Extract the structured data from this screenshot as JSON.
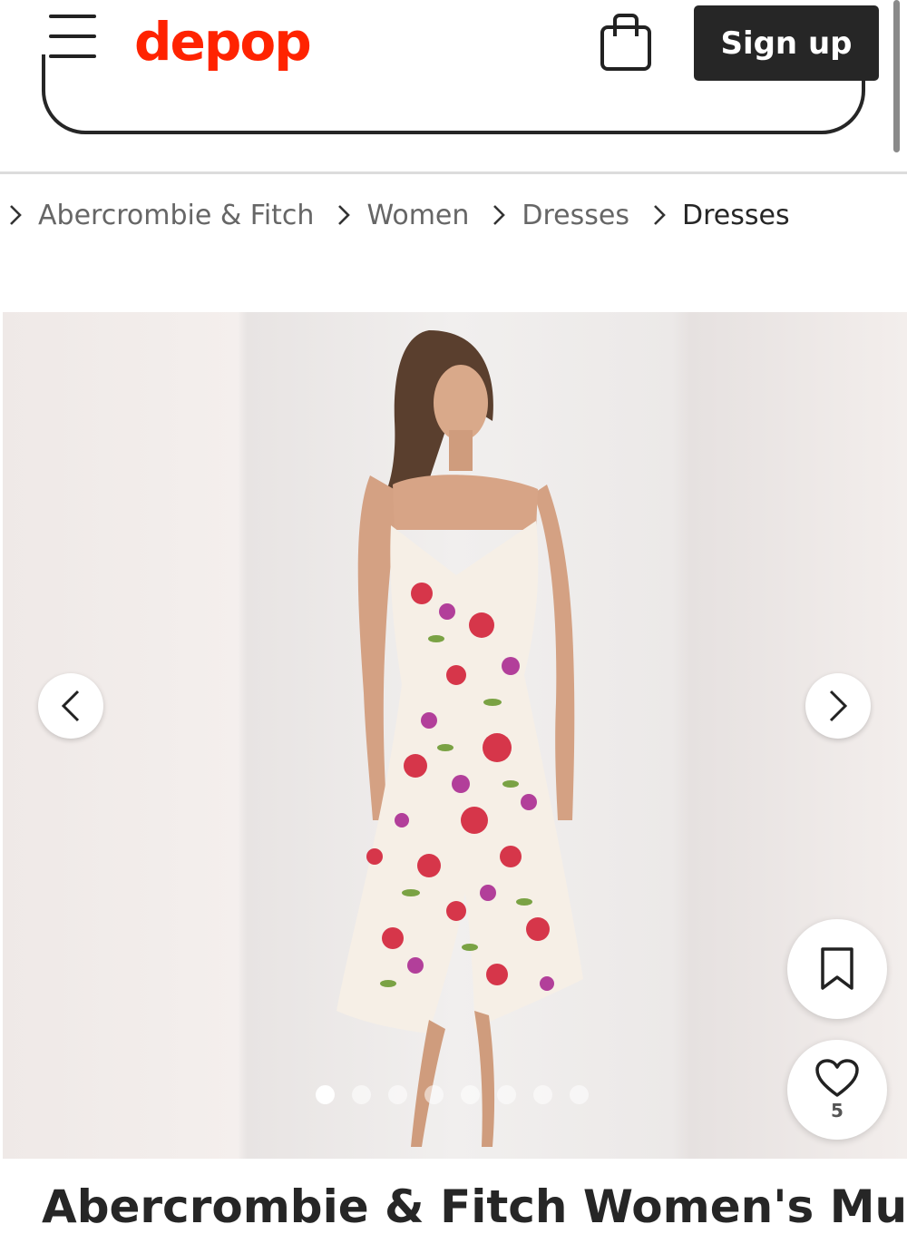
{
  "brand": {
    "logo_text": "depop",
    "logo_color": "#ff2300"
  },
  "header": {
    "signup_label": "Sign up",
    "menu_icon": "hamburger-menu-icon",
    "bag_icon": "shopping-bag-icon"
  },
  "breadcrumb": {
    "items": [
      "Abercrombie & Fitch",
      "Women",
      "Dresses"
    ],
    "current": "Dresses"
  },
  "gallery": {
    "image_count": 8,
    "active_index": 0,
    "prev_icon": "chevron-left-icon",
    "next_icon": "chevron-right-icon"
  },
  "actions": {
    "save_icon": "bookmark-icon",
    "like_icon": "heart-icon",
    "like_count": "5"
  },
  "product": {
    "title_partial": "Abercrombie & Fitch Women's Multi"
  }
}
